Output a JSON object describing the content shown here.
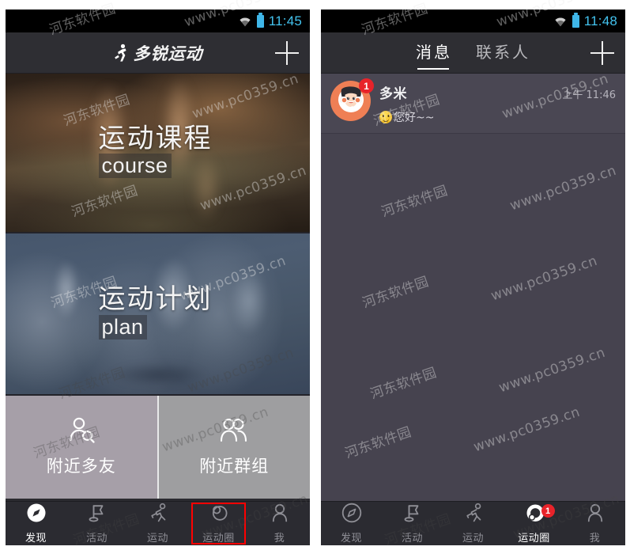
{
  "left_phone": {
    "status_bar": {
      "time": "11:45",
      "wifi_icon": "wifi-icon",
      "battery_icon": "battery-icon"
    },
    "title_bar": {
      "logo_icon": "running-person-logo-icon",
      "title": "多锐运动",
      "add_label": "+"
    },
    "cards": [
      {
        "cn": "运动课程",
        "en": "course",
        "name": "course-card"
      },
      {
        "cn": "运动计划",
        "en": "plan",
        "name": "plan-card"
      }
    ],
    "tiles": [
      {
        "label": "附近多友",
        "icon": "person-search-icon"
      },
      {
        "label": "附近群组",
        "icon": "group-people-icon"
      }
    ],
    "nav": [
      {
        "label": "发现",
        "icon": "compass-icon",
        "active": true
      },
      {
        "label": "活动",
        "icon": "flag-icon",
        "active": false
      },
      {
        "label": "运动",
        "icon": "runner-icon",
        "active": false
      },
      {
        "label": "运动圈",
        "icon": "circle-group-icon",
        "active": false,
        "highlighted": true
      },
      {
        "label": "我",
        "icon": "person-icon",
        "active": false
      }
    ]
  },
  "right_phone": {
    "status_bar": {
      "time": "11:48",
      "wifi_icon": "wifi-icon",
      "battery_icon": "battery-icon"
    },
    "tab_bar": {
      "tabs": [
        {
          "label": "消息",
          "active": true
        },
        {
          "label": "联系人",
          "active": false
        }
      ],
      "add_label": "+"
    },
    "messages": [
      {
        "name": "多米",
        "time": "上午 11:46",
        "preview": "您好~~",
        "preview_emoji": "smile-emoji-icon",
        "badge": "1",
        "avatar_icon": "headset-girl-avatar-icon"
      }
    ],
    "nav": [
      {
        "label": "发现",
        "icon": "compass-icon",
        "active": false
      },
      {
        "label": "活动",
        "icon": "flag-icon",
        "active": false
      },
      {
        "label": "运动",
        "icon": "runner-icon",
        "active": false
      },
      {
        "label": "运动圈",
        "icon": "circle-group-icon",
        "active": true,
        "badge": "1"
      },
      {
        "label": "我",
        "icon": "person-icon",
        "active": false
      }
    ]
  },
  "watermarks": [
    "河东软件园",
    "www.pc0359.cn"
  ],
  "colors": {
    "accent_red": "#e8232a",
    "status_time": "#43c3ef",
    "battery": "#3fb6e8",
    "nav_bg": "#2b2b31",
    "right_body": "#46434f",
    "tile_friends": "#a69fa8",
    "tile_groups": "#9e9ea0",
    "avatar_bg": "#ef7f55"
  }
}
